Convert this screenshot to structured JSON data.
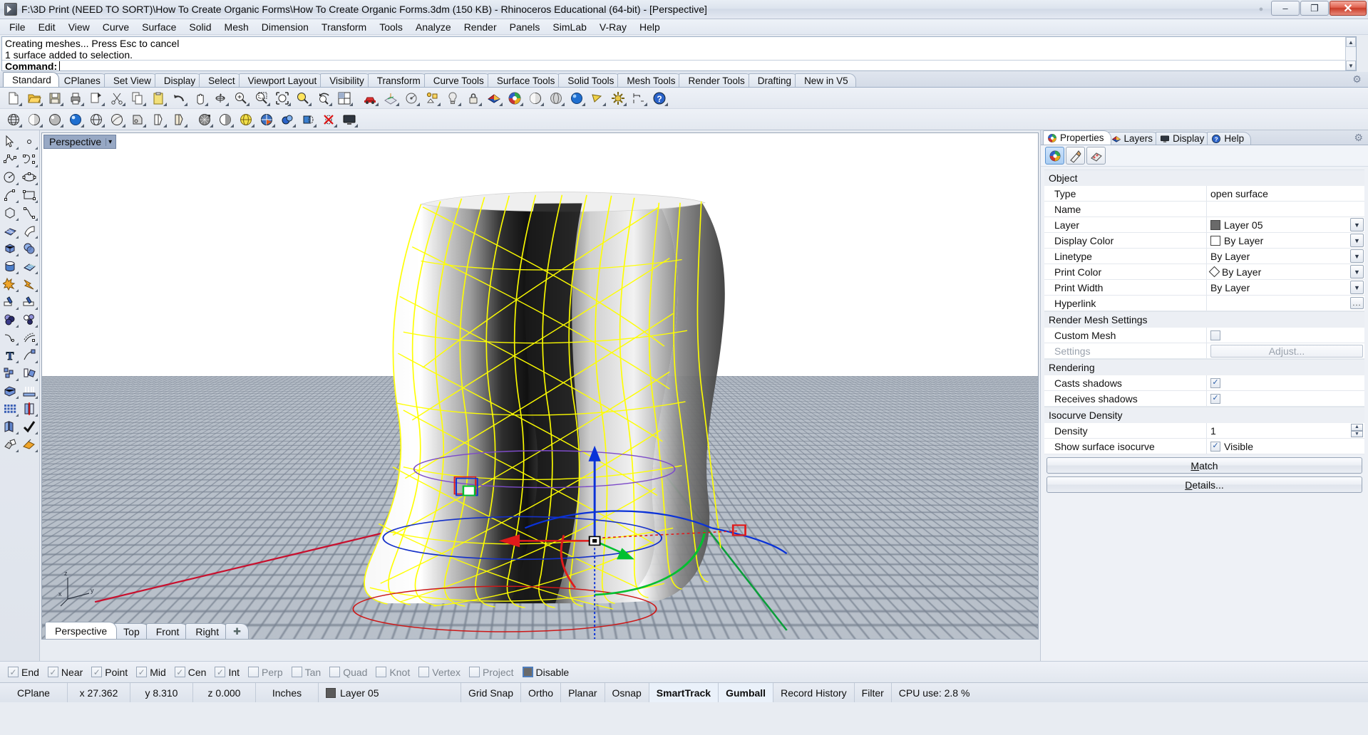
{
  "window": {
    "title": "F:\\3D Print (NEED TO SORT)\\How To Create Organic Forms\\How To Create Organic Forms.3dm (150 KB) - Rhinoceros Educational (64-bit) - [Perspective]",
    "minimize": "–",
    "maximize": "❐",
    "close": "✕"
  },
  "menu": {
    "items": [
      "File",
      "Edit",
      "View",
      "Curve",
      "Surface",
      "Solid",
      "Mesh",
      "Dimension",
      "Transform",
      "Tools",
      "Analyze",
      "Render",
      "Panels",
      "SimLab",
      "V-Ray",
      "Help"
    ]
  },
  "command": {
    "history": [
      "Creating meshes... Press Esc to cancel",
      "1 surface added to selection."
    ],
    "prompt_label": "Command:",
    "prompt_value": "",
    "scroll_up": "▲",
    "scroll_down": "▼"
  },
  "toolbar_tabs": {
    "items": [
      "Standard",
      "CPlanes",
      "Set View",
      "Display",
      "Select",
      "Viewport Layout",
      "Visibility",
      "Transform",
      "Curve Tools",
      "Surface Tools",
      "Solid Tools",
      "Mesh Tools",
      "Render Tools",
      "Drafting",
      "New in V5"
    ],
    "active": "Standard",
    "options_icon": "gear-icon"
  },
  "standard_toolbar": {
    "row1": [
      {
        "name": "new-file-icon"
      },
      {
        "name": "open-file-icon"
      },
      {
        "name": "save-icon"
      },
      {
        "name": "print-icon"
      },
      {
        "name": "copy-viewport-icon"
      },
      {
        "name": "cut-icon"
      },
      {
        "name": "copy-icon"
      },
      {
        "name": "paste-icon"
      },
      {
        "name": "undo-icon"
      },
      {
        "name": "pan-icon"
      },
      {
        "name": "rotate-view-icon"
      },
      {
        "name": "zoom-in-icon"
      },
      {
        "name": "zoom-window-icon"
      },
      {
        "name": "zoom-extents-icon"
      },
      {
        "name": "zoom-selected-icon"
      },
      {
        "name": "zoom-previous-icon"
      },
      {
        "name": "viewport-layout-icon"
      },
      {
        "name": "vehicle-icon"
      },
      {
        "name": "cplane-icon"
      },
      {
        "name": "named-view-icon"
      },
      {
        "name": "group-icon"
      },
      {
        "name": "light-icon"
      },
      {
        "name": "lock-icon"
      },
      {
        "name": "layers-icon"
      },
      {
        "name": "color-wheel-icon"
      },
      {
        "name": "shaded-sphere-icon"
      },
      {
        "name": "ghosted-sphere-icon"
      },
      {
        "name": "render-sphere-icon"
      },
      {
        "name": "render-preview-icon"
      },
      {
        "name": "options-gear-icon"
      },
      {
        "name": "dimension-icon"
      },
      {
        "name": "help-icon"
      }
    ],
    "row2": [
      {
        "name": "wireframe-globe-icon"
      },
      {
        "name": "shaded-view-icon"
      },
      {
        "name": "rendered-view-icon"
      },
      {
        "name": "arctic-view-icon"
      },
      {
        "name": "ghosted-view-icon"
      },
      {
        "name": "xray-view-icon"
      },
      {
        "name": "technical-view-icon"
      },
      {
        "name": "artistic-view-icon"
      },
      {
        "name": "pen-view-icon"
      },
      {
        "name": "render-mesh-icon"
      },
      {
        "name": "half-shade-icon"
      },
      {
        "name": "yellow-globe-icon"
      },
      {
        "name": "target-sphere-icon"
      },
      {
        "name": "camera-icon"
      },
      {
        "name": "clipping-plane-icon"
      },
      {
        "name": "delete-clip-icon"
      },
      {
        "name": "monitor-icon"
      }
    ]
  },
  "left_toolbar": {
    "items": [
      {
        "name": "select-arrow-icon"
      },
      {
        "name": "point-icon"
      },
      {
        "name": "polyline-icon"
      },
      {
        "name": "control-point-curve-icon"
      },
      {
        "name": "circle-icon"
      },
      {
        "name": "ellipse-icon"
      },
      {
        "name": "arc-icon"
      },
      {
        "name": "rectangle-icon"
      },
      {
        "name": "polygon-icon"
      },
      {
        "name": "free-form-curve-icon"
      },
      {
        "name": "surface-from-points-icon"
      },
      {
        "name": "extrude-surface-icon"
      },
      {
        "name": "box-icon"
      },
      {
        "name": "boolean-icon"
      },
      {
        "name": "cylinder-icon"
      },
      {
        "name": "surface-tools-icon"
      },
      {
        "name": "explode-icon"
      },
      {
        "name": "join-icon"
      },
      {
        "name": "trim-icon"
      },
      {
        "name": "split-icon"
      },
      {
        "name": "mesh-bool-icon"
      },
      {
        "name": "circle-arrange-icon"
      },
      {
        "name": "fillet-curve-icon"
      },
      {
        "name": "offset-curve-icon"
      },
      {
        "name": "text-icon"
      },
      {
        "name": "move-icon"
      },
      {
        "name": "copy-objects-icon"
      },
      {
        "name": "rotate-icon"
      },
      {
        "name": "scale-icon"
      },
      {
        "name": "array-lift-icon"
      },
      {
        "name": "array-grid-icon"
      },
      {
        "name": "mirror-icon"
      },
      {
        "name": "blend-surface-icon"
      },
      {
        "name": "check-icon"
      },
      {
        "name": "analyze-icon"
      },
      {
        "name": "paint-icon"
      }
    ]
  },
  "viewport": {
    "title": "Perspective",
    "dropdown_arrow": "▾",
    "tabs": [
      "Perspective",
      "Top",
      "Front",
      "Right"
    ],
    "active_tab": "Perspective",
    "add_tab": "✚",
    "axis_labels": {
      "x": "x",
      "y": "y",
      "z": "z"
    },
    "colors": {
      "background": "#ffffff",
      "ground": "#bcc3cc",
      "isocurve_selected": "#ffff00",
      "x_axis": "#c8102e",
      "y_axis": "#0b9e3a",
      "gumball_z": "#0a32d8",
      "gumball_x": "#e01b1b",
      "gumball_y": "#00c030"
    }
  },
  "right_panel": {
    "tabs": [
      {
        "label": "Properties",
        "icon": "color-wheel-icon"
      },
      {
        "label": "Layers",
        "icon": "layers-icon"
      },
      {
        "label": "Display",
        "icon": "monitor-icon"
      },
      {
        "label": "Help",
        "icon": "help-icon"
      }
    ],
    "active_tab": "Properties",
    "options_icon": "gear-icon",
    "icon_buttons": [
      {
        "name": "object-properties-icon",
        "selected": true
      },
      {
        "name": "material-properties-icon",
        "selected": false
      },
      {
        "name": "texture-mapping-icon",
        "selected": false
      }
    ],
    "groups": [
      {
        "title": "Object",
        "rows": [
          {
            "key": "Type",
            "value": "open surface",
            "control": "text"
          },
          {
            "key": "Name",
            "value": "",
            "control": "text"
          },
          {
            "key": "Layer",
            "value": "Layer 05",
            "control": "dropdown",
            "swatch": "gray"
          },
          {
            "key": "Display Color",
            "value": "By Layer",
            "control": "dropdown",
            "swatch": "white"
          },
          {
            "key": "Linetype",
            "value": "By Layer",
            "control": "dropdown"
          },
          {
            "key": "Print Color",
            "value": "By Layer",
            "control": "dropdown",
            "swatch": "diamond"
          },
          {
            "key": "Print Width",
            "value": "By Layer",
            "control": "dropdown"
          },
          {
            "key": "Hyperlink",
            "value": "",
            "control": "ellipsis",
            "ellipsis_label": "..."
          }
        ]
      },
      {
        "title": "Render Mesh Settings",
        "rows": [
          {
            "key": "Custom Mesh",
            "value": "",
            "control": "checkbox",
            "checked": false
          },
          {
            "key": "Settings",
            "value": "Adjust...",
            "control": "button",
            "disabled": true
          }
        ]
      },
      {
        "title": "Rendering",
        "rows": [
          {
            "key": "Casts shadows",
            "value": "",
            "control": "checkbox",
            "checked": true
          },
          {
            "key": "Receives shadows",
            "value": "",
            "control": "checkbox",
            "checked": true
          }
        ]
      },
      {
        "title": "Isocurve Density",
        "rows": [
          {
            "key": "Density",
            "value": "1",
            "control": "spinner"
          },
          {
            "key": "Show surface isocurve",
            "value": "Visible",
            "control": "checkbox",
            "checked": true
          }
        ]
      }
    ],
    "buttons": [
      {
        "label": "Match",
        "accel": "M"
      },
      {
        "label": "Details...",
        "accel": "D"
      }
    ]
  },
  "osnap": {
    "items": [
      {
        "label": "End",
        "checked": true
      },
      {
        "label": "Near",
        "checked": true
      },
      {
        "label": "Point",
        "checked": true
      },
      {
        "label": "Mid",
        "checked": true
      },
      {
        "label": "Cen",
        "checked": true
      },
      {
        "label": "Int",
        "checked": true
      },
      {
        "label": "Perp",
        "checked": false
      },
      {
        "label": "Tan",
        "checked": false
      },
      {
        "label": "Quad",
        "checked": false
      },
      {
        "label": "Knot",
        "checked": false
      },
      {
        "label": "Vertex",
        "checked": false
      },
      {
        "label": "Project",
        "checked": false
      }
    ],
    "disable_label": "Disable",
    "check_glyph": "✓"
  },
  "statusbar": {
    "cplane_label": "CPlane",
    "x": "x 27.362",
    "y": "y 8.310",
    "z": "z 0.000",
    "units": "Inches",
    "layer": "Layer 05",
    "layer_color": "#5a5a5a",
    "toggles": [
      {
        "label": "Grid Snap",
        "on": false
      },
      {
        "label": "Ortho",
        "on": false
      },
      {
        "label": "Planar",
        "on": false
      },
      {
        "label": "Osnap",
        "on": false
      },
      {
        "label": "SmartTrack",
        "on": true
      },
      {
        "label": "Gumball",
        "on": true
      },
      {
        "label": "Record History",
        "on": false
      },
      {
        "label": "Filter",
        "on": false
      }
    ],
    "cpu": "CPU use: 2.8 %"
  }
}
